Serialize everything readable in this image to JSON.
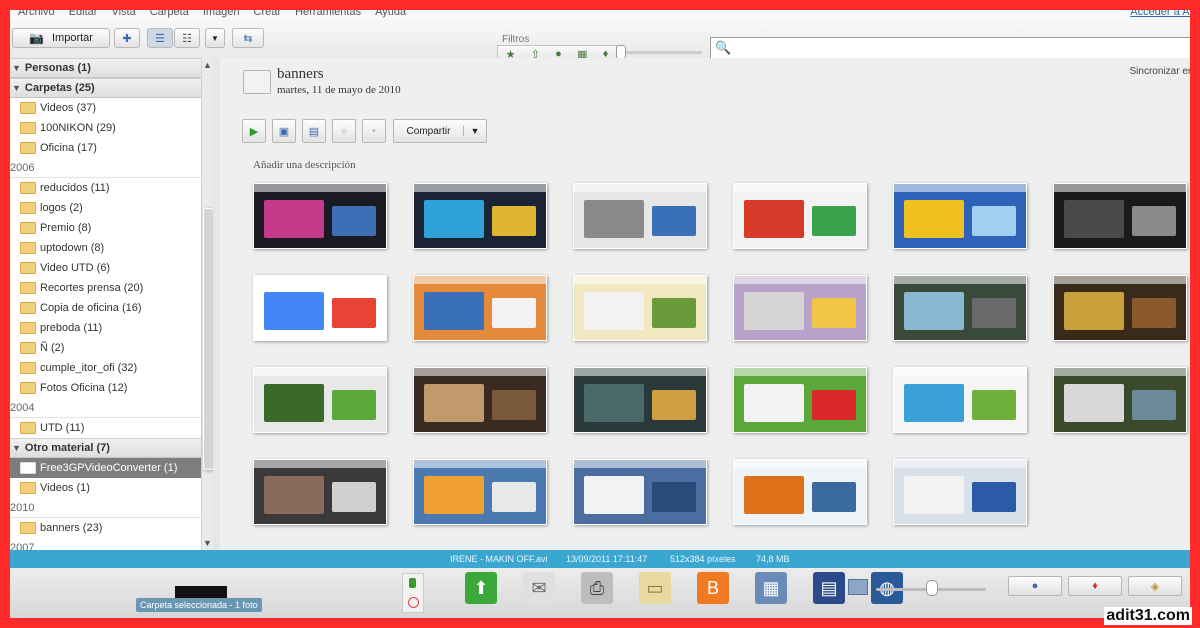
{
  "menu": [
    "Archivo",
    "Editar",
    "Vista",
    "Carpeta",
    "Imagen",
    "Crear",
    "Herramientas",
    "Ayuda"
  ],
  "signin": "Acceder a Al",
  "toolbar": {
    "import_label": "Importar",
    "filters_label": "Filtros"
  },
  "sidebar": {
    "rows": [
      {
        "type": "section",
        "label": "Personas (1)"
      },
      {
        "type": "section",
        "label": "Carpetas (25)"
      },
      {
        "type": "folder",
        "label": "Videos (37)"
      },
      {
        "type": "folder",
        "label": "100NIKON (29)"
      },
      {
        "type": "folder",
        "label": "Oficina (17)"
      },
      {
        "type": "year",
        "label": "2006"
      },
      {
        "type": "folder",
        "label": "reducidos (11)"
      },
      {
        "type": "folder",
        "label": "logos (2)"
      },
      {
        "type": "folder",
        "label": "Premio (8)"
      },
      {
        "type": "folder",
        "label": "uptodown (8)"
      },
      {
        "type": "folder",
        "label": "Video UTD (6)"
      },
      {
        "type": "folder",
        "label": "Recortes prensa (20)"
      },
      {
        "type": "folder",
        "label": "Copia de oficina (16)"
      },
      {
        "type": "folder",
        "label": "preboda (11)"
      },
      {
        "type": "folder",
        "label": "Ñ (2)"
      },
      {
        "type": "folder",
        "label": "cumple_itor_ofi (32)"
      },
      {
        "type": "folder",
        "label": "Fotos Oficina (12)"
      },
      {
        "type": "year",
        "label": "2004"
      },
      {
        "type": "folder",
        "label": "UTD (11)"
      },
      {
        "type": "section",
        "label": "Otro material (7)"
      },
      {
        "type": "folder",
        "label": "Free3GPVideoConverter (1)",
        "selected": true
      },
      {
        "type": "folder",
        "label": "Videos (1)"
      },
      {
        "type": "year",
        "label": "2010"
      },
      {
        "type": "folder",
        "label": "banners (23)"
      },
      {
        "type": "year",
        "label": "2007"
      }
    ]
  },
  "album": {
    "title": "banners",
    "date": "martes, 11 de mayo de 2010",
    "sync_label": "Sincronizar en la",
    "share_label": "Compartir",
    "add_description": "Añadir una descripción"
  },
  "thumbnails": [
    {
      "bg": "#1a1a22",
      "a": "#c53a8a",
      "b": "#3c6fb5"
    },
    {
      "bg": "#1b2435",
      "a": "#2fa3d8",
      "b": "#e0b530"
    },
    {
      "bg": "#e6e6e6",
      "a": "#8a8a8a",
      "b": "#3a70b8"
    },
    {
      "bg": "#f2f2f2",
      "a": "#d83a2a",
      "b": "#3aa24a"
    },
    {
      "bg": "#2d62b8",
      "a": "#f0c020",
      "b": "#9fd0f0"
    },
    {
      "bg": "#1a1a1a",
      "a": "#4a4a4a",
      "b": "#8a8a8a"
    },
    {
      "bg": "#ffffff",
      "a": "#4285f4",
      "b": "#ea4335"
    },
    {
      "bg": "#e48a3a",
      "a": "#3a70b8",
      "b": "#f2f2f2"
    },
    {
      "bg": "#f3e9c0",
      "a": "#f2f2f2",
      "b": "#6a9a3a"
    },
    {
      "bg": "#b8a2c9",
      "a": "#d5d5d5",
      "b": "#f1c645"
    },
    {
      "bg": "#3a4a3a",
      "a": "#8ab8d0",
      "b": "#6a6a6a"
    },
    {
      "bg": "#3a2a1a",
      "a": "#c8a03a",
      "b": "#8a5a2a"
    },
    {
      "bg": "#e8e8e8",
      "a": "#3a6a2a",
      "b": "#5aa83a"
    },
    {
      "bg": "#3a2a22",
      "a": "#c09a6a",
      "b": "#7a5a3a"
    },
    {
      "bg": "#2a3a3a",
      "a": "#4a6a6a",
      "b": "#d0a040"
    },
    {
      "bg": "#5aa83a",
      "a": "#f2f2f2",
      "b": "#d8282a"
    },
    {
      "bg": "#f5f5f5",
      "a": "#3aa0d8",
      "b": "#6fb03a"
    },
    {
      "bg": "#3a4a2a",
      "a": "#d8d8d8",
      "b": "#6a8a9a"
    },
    {
      "bg": "#3a3a3a",
      "a": "#8a6a5a",
      "b": "#d0d0d0"
    },
    {
      "bg": "#4a7ab0",
      "a": "#f0a030",
      "b": "#e8e8e8"
    },
    {
      "bg": "#4a6ea0",
      "a": "#f2f2f2",
      "b": "#2a4a7a"
    },
    {
      "bg": "#eef3f8",
      "a": "#e0701a",
      "b": "#3a6aa0"
    },
    {
      "bg": "#d8e0ea",
      "a": "#f2f2f2",
      "b": "#2a5aa8"
    }
  ],
  "status": {
    "file": "IRENE - MAKIN OFF.avi",
    "datetime": "13/09/2011 17:11:47",
    "dims": "512x384 píxeles",
    "size": "74,8 MB"
  },
  "tray": {
    "selected_label": "Carpeta seleccionada - 1 foto"
  },
  "watermark": "adit31.com",
  "colors": {
    "frame": "#ff2a2a",
    "status_bar": "#39a7cf",
    "selected_row": "#7d7d7d"
  }
}
